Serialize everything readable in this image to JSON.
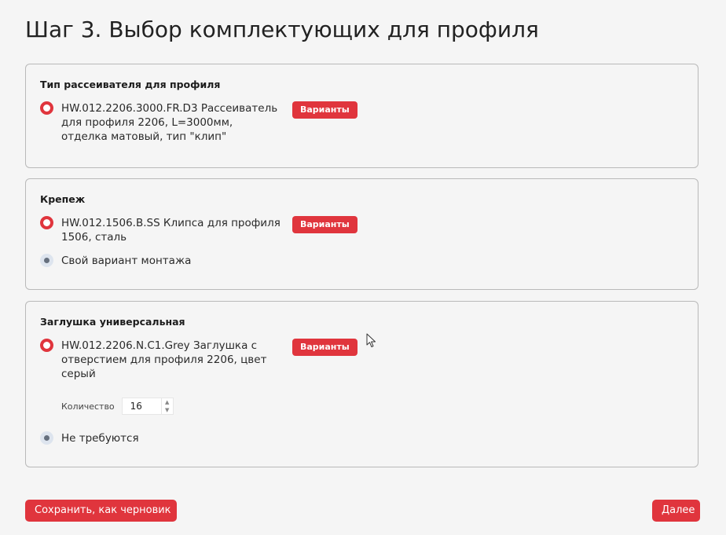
{
  "page": {
    "title": "Шаг 3. Выбор комплектующих для профиля"
  },
  "sections": [
    {
      "title": "Тип рассеивателя для профиля",
      "options": [
        {
          "label": "HW.012.2206.3000.FR.D3 Рассеиватель для профиля 2206, L=3000мм, отделка матовый, тип \"клип\"",
          "selected": true,
          "variants_label": "Варианты"
        }
      ]
    },
    {
      "title": "Крепеж",
      "options": [
        {
          "label": "HW.012.1506.B.SS Клипса для профиля 1506, сталь",
          "selected": true,
          "variants_label": "Варианты"
        },
        {
          "label": "Свой вариант монтажа",
          "selected": false
        }
      ]
    },
    {
      "title": "Заглушка универсальная",
      "options": [
        {
          "label": "HW.012.2206.N.C1.Grey Заглушка с отверстием для профиля 2206, цвет серый",
          "selected": true,
          "variants_label": "Варианты"
        },
        {
          "label": "Не требуются",
          "selected": false
        }
      ],
      "quantity": {
        "label": "Количество",
        "value": "16"
      }
    }
  ],
  "footer": {
    "save_draft_label": "Сохранить, как черновик",
    "next_label": "Далее"
  },
  "colors": {
    "accent": "#e0353d",
    "border": "#b9b9b9",
    "background": "#f5f5f5"
  }
}
